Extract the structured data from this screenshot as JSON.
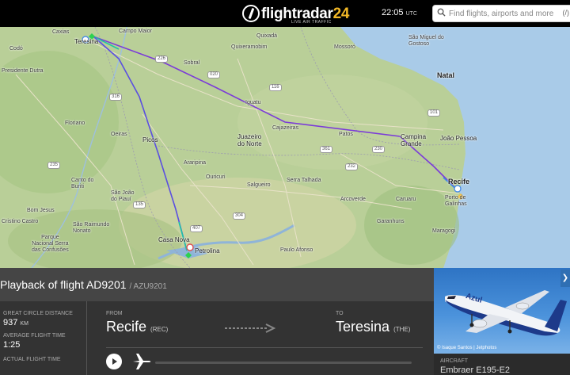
{
  "header": {
    "logo_text": "flightradar",
    "logo_num": "24",
    "logo_sub": "LIVE AIR TRAFFIC",
    "time": "22:05",
    "tz": "UTC",
    "search_placeholder": "Find flights, airports and more",
    "search_shortcut": "(/)"
  },
  "map": {
    "places": {
      "caxias": "Caxias",
      "teresina": "Teresina",
      "campo_maior": "Campo Maior",
      "quixada": "Quixadá",
      "quixeramobim": "Quixeramobim",
      "mossoro": "Mossoró",
      "sao_miguel_do_gostoso": "São Miguel do Gostoso",
      "natal": "Natal",
      "iguatu": "Iguatu",
      "juazeiro": "Juazeiro\ndo Norte",
      "cajazeiras": "Cajazeiras",
      "patos": "Patos",
      "campina_grande": "Campina\nGrande",
      "joao_pessoa": "João Pessoa",
      "recife": "Recife",
      "porto_galinhas": "Porto de\nGalinhas",
      "floriano": "Floriano",
      "oeiras": "Oeiras",
      "picos": "Picos",
      "araripina": "Araripina",
      "ouricuri": "Ouricuri",
      "salgueiro": "Salgueiro",
      "serra_talhada": "Serra Talhada",
      "canto_buriti": "Canto do\nBuriti",
      "sao_joao_piaui": "São João\ndo Piauí",
      "sao_raimundo": "São Raimundo\nNonato",
      "casa_nova": "Casa Nova",
      "petrolina": "Petrolina",
      "maragogi": "Maragogi",
      "cristino_castro": "Cristino Castro",
      "bom_jesus": "Bom Jesus",
      "parque": "Parque\nNacional Serra\ndas Confusões",
      "caruaru": "Caruaru",
      "paulo_afonso": "Paulo Afonso",
      "arcoverde": "Arcoverde",
      "garanhuns": "Garanhuns",
      "sobral": "Sobral",
      "codo": "Codó",
      "presidente_dutra": "Presidente Dutra"
    },
    "roads": [
      "226",
      "316",
      "020",
      "116",
      "232",
      "230",
      "407",
      "361",
      "304",
      "101",
      "135",
      "235"
    ]
  },
  "flight": {
    "title": "Playback of flight AD9201",
    "callsign": "/ AZU9201",
    "gcd_label": "GREAT CIRCLE DISTANCE",
    "gcd_value": "937",
    "gcd_unit": "KM",
    "avg_label": "AVERAGE FLIGHT TIME",
    "avg_value": "1:25",
    "actual_label": "ACTUAL FLIGHT TIME",
    "from_label": "FROM",
    "from_city": "Recife",
    "from_code": "(REC)",
    "to_label": "TO",
    "to_city": "Teresina",
    "to_code": "(THE)"
  },
  "aircraft": {
    "credit": "© Isaque Santos | Jetphotos",
    "label": "AIRCRAFT",
    "model": "Embraer E195-E2",
    "livery": "Azul"
  }
}
